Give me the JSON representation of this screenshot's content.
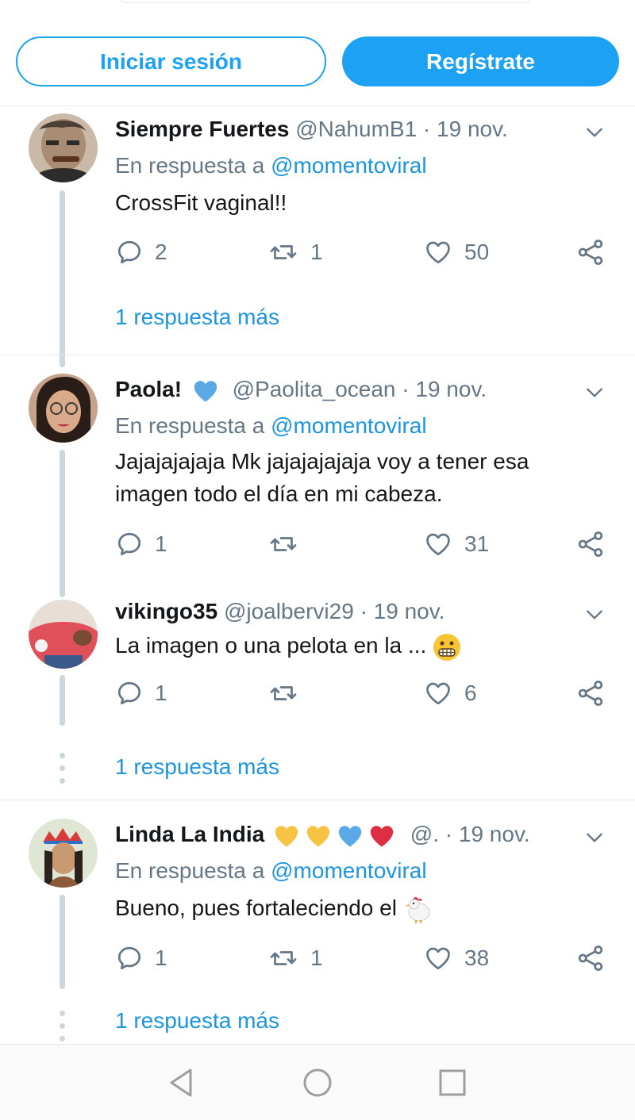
{
  "header": {
    "login_label": "Iniciar sesión",
    "signup_label": "Regístrate"
  },
  "colors": {
    "accent": "#1da1f2",
    "link": "#1b95e0",
    "muted": "#657786",
    "thread": "#ccd6dd"
  },
  "tweets": [
    {
      "name": "Siempre Fuertes",
      "handle": "@NahumB1",
      "date": "· 19 nov.",
      "reply_prefix": "En respuesta a",
      "reply_to": "@momentoviral",
      "text": "CrossFit vaginal!!",
      "replies": "2",
      "retweets": "1",
      "likes": "50",
      "more": "1 respuesta más"
    },
    {
      "name": "Paola!",
      "name_emoji": "blue-heart",
      "handle": "@Paolita_ocean",
      "date": "· 19 nov.",
      "reply_prefix": "En respuesta a",
      "reply_to": "@momentoviral",
      "text_line1": "Jajajajajaja Mk jajajajajaja voy a tener esa",
      "text_line2": "imagen todo el día en mi cabeza.",
      "replies": "1",
      "retweets": "",
      "likes": "31"
    },
    {
      "name": "vikingo35",
      "handle": "@joalbervi29",
      "date": "· 19 nov.",
      "text": "La imagen o una pelota en la ...",
      "text_emoji": "grimacing-face",
      "replies": "1",
      "retweets": "",
      "likes": "6",
      "more": "1 respuesta más"
    },
    {
      "name": "Linda La India",
      "name_emojis": [
        "yellow-heart",
        "yellow-heart",
        "blue-heart",
        "red-heart"
      ],
      "handle": "@.",
      "date": "· 19 nov.",
      "reply_prefix": "En respuesta a",
      "reply_to": "@momentoviral",
      "text": "Bueno, pues fortaleciendo el",
      "text_emoji": "chicken",
      "replies": "1",
      "retweets": "1",
      "likes": "38",
      "more": "1 respuesta más"
    }
  ],
  "navbar": {
    "icons": [
      "back-icon",
      "home-icon",
      "recents-icon"
    ]
  }
}
